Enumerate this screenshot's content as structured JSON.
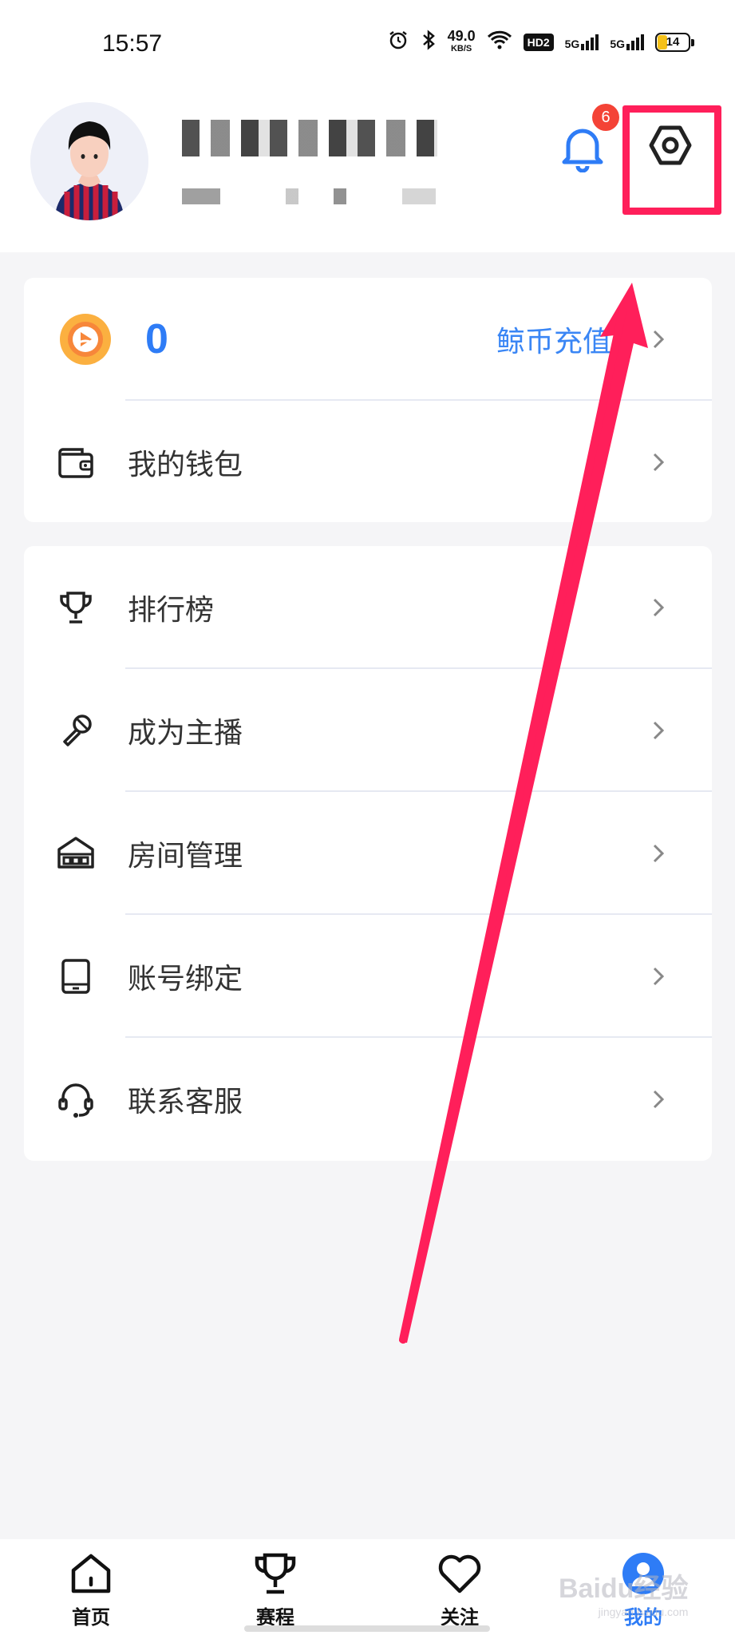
{
  "status_bar": {
    "time": "15:57",
    "net_speed_value": "49.0",
    "net_speed_unit": "KB/S",
    "hd_label": "HD2",
    "sim1": "5G",
    "sim2": "5G",
    "battery": "14"
  },
  "header": {
    "notification_count": "6"
  },
  "wallet_card": {
    "coin_amount": "0",
    "recharge_label": "鲸币充值",
    "wallet_label": "我的钱包"
  },
  "menu": {
    "items": [
      {
        "label": "排行榜",
        "icon": "trophy-icon"
      },
      {
        "label": "成为主播",
        "icon": "microphone-icon"
      },
      {
        "label": "房间管理",
        "icon": "room-icon"
      },
      {
        "label": "账号绑定",
        "icon": "tablet-icon"
      },
      {
        "label": "联系客服",
        "icon": "headset-icon"
      }
    ]
  },
  "tabbar": {
    "tabs": [
      {
        "label": "首页",
        "icon": "home-icon"
      },
      {
        "label": "赛程",
        "icon": "trophy-icon"
      },
      {
        "label": "关注",
        "icon": "heart-icon"
      },
      {
        "label": "我的",
        "icon": "profile-icon"
      }
    ],
    "active_index": 3
  },
  "watermark": {
    "text": "Baidu经验",
    "sub": "jingyan.baidu.com"
  },
  "colors": {
    "accent_blue": "#2e7cf6",
    "annotation_pink": "#ff1f5a",
    "badge_red": "#f44336"
  }
}
